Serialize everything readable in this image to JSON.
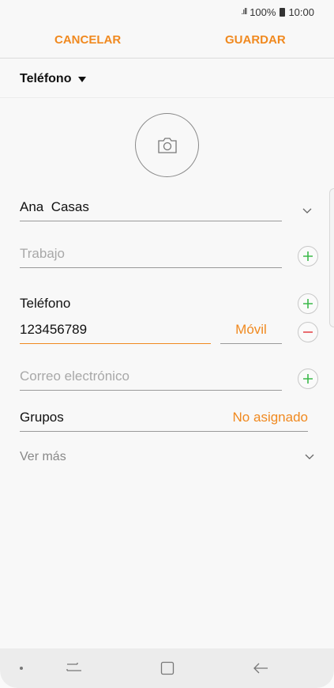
{
  "status": {
    "signal_icon": "signal-icon",
    "battery_percent": "100%",
    "time": "10:00"
  },
  "actions": {
    "cancel": "CANCELAR",
    "save": "GUARDAR"
  },
  "account": {
    "label": "Teléfono"
  },
  "name": {
    "value": "Ana  Casas"
  },
  "work": {
    "placeholder": "Trabajo"
  },
  "phone": {
    "label": "Teléfono",
    "number": "123456789",
    "type": "Móvil"
  },
  "email": {
    "placeholder": "Correo electrónico"
  },
  "groups": {
    "label": "Grupos",
    "value": "No asignado"
  },
  "more": {
    "label": "Ver más"
  },
  "colors": {
    "accent": "#f0891f",
    "add": "#3cb94b",
    "remove": "#e5484d"
  }
}
